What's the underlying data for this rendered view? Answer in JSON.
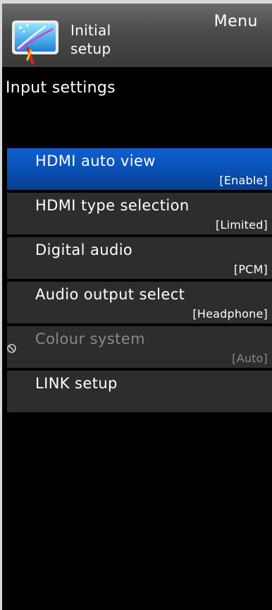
{
  "header": {
    "icon": "initial-setup-icon",
    "title_line1": "Initial",
    "title_line2": "setup",
    "menu_label": "Menu"
  },
  "section": {
    "title": "Input settings"
  },
  "colors": {
    "selected": "#0a4fb3",
    "item_bg": "#2d2d2d",
    "disabled_text": "#8a8a8a"
  },
  "items": [
    {
      "label": "HDMI auto view",
      "value": "[Enable]",
      "state": "selected"
    },
    {
      "label": "HDMI type selection",
      "value": "[Limited]",
      "state": "normal"
    },
    {
      "label": "Digital audio",
      "value": "[PCM]",
      "state": "normal"
    },
    {
      "label": "Audio output select",
      "value": "[Headphone]",
      "state": "normal"
    },
    {
      "label": "Colour system",
      "value": "[Auto]",
      "state": "disabled",
      "icon": "prohibited-icon"
    },
    {
      "label": "LINK setup",
      "value": "",
      "state": "normal"
    }
  ]
}
